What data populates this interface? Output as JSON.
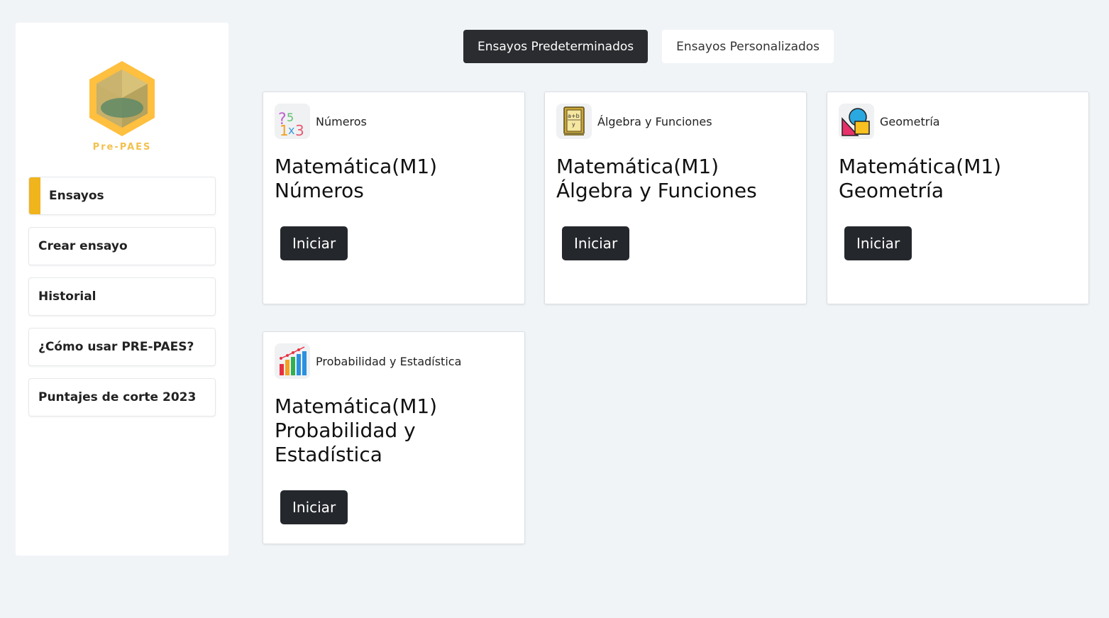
{
  "sidebar": {
    "logo_text": "Pre-PAES",
    "items": [
      {
        "label": "Ensayos"
      },
      {
        "label": "Crear ensayo"
      },
      {
        "label": "Historial"
      },
      {
        "label": "¿Cómo usar PRE-PAES?"
      },
      {
        "label": "Puntajes de corte 2023"
      }
    ]
  },
  "tabs": [
    {
      "label": "Ensayos Predeterminados"
    },
    {
      "label": "Ensayos Personalizados"
    }
  ],
  "cards": [
    {
      "subject": "Números",
      "title_line1": "Matemática(M1)",
      "title_line2": "Números",
      "button": "Iniciar",
      "icon": "numbers-icon"
    },
    {
      "subject": "Álgebra y Funciones",
      "title_line1": "Matemática(M1)",
      "title_line2": "Álgebra y Funciones",
      "button": "Iniciar",
      "icon": "algebra-book-icon"
    },
    {
      "subject": "Geometría",
      "title_line1": "Matemática(M1)",
      "title_line2": "Geometría",
      "button": "Iniciar",
      "icon": "geometry-shapes-icon"
    },
    {
      "subject": "Probabilidad y Estadística",
      "title_line1": "Matemática(M1)",
      "title_line2": "Probabilidad y Estadística",
      "button": "Iniciar",
      "icon": "bar-chart-icon"
    }
  ],
  "colors": {
    "accent": "#f0b41c",
    "dark_button": "#24272b",
    "background": "#f1f4f7"
  }
}
